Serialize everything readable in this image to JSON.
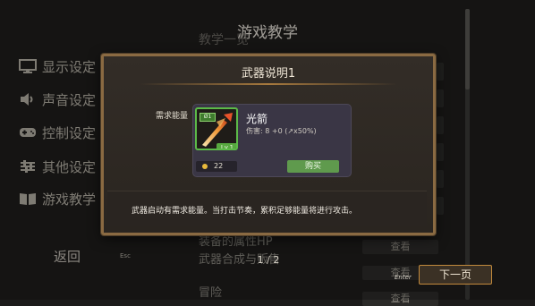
{
  "screen": {
    "title": "游戏教学"
  },
  "left_menu": {
    "items": [
      {
        "label": "显示设定",
        "icon": "monitor-icon"
      },
      {
        "label": "声音设定",
        "icon": "speaker-icon"
      },
      {
        "label": "控制设定",
        "icon": "gamepad-icon"
      },
      {
        "label": "其他设定",
        "icon": "sliders-icon"
      },
      {
        "label": "游戏教学",
        "icon": "book-icon"
      }
    ],
    "back_label": "返回",
    "back_key": "Esc"
  },
  "tutorial_list": {
    "header": "教学一览",
    "rows": [
      "装备的属性HP",
      "武器合成与贩售",
      "冒险"
    ],
    "view_label": "查看"
  },
  "pager": {
    "page": "1 / 2",
    "next_label": "下一页",
    "next_key": "Enter"
  },
  "dialog": {
    "title": "武器说明1",
    "energy_label": "需求能量",
    "weapon": {
      "name": "光箭",
      "badge": "Ø1",
      "level": "Lv.1",
      "stats": "伤害: 8 +0 (↗x50%)",
      "price": "22",
      "buy_label": "购买"
    },
    "description": "武器启动有需求能量。当打击节奏，累积足够能量将进行攻击。"
  },
  "colors": {
    "accent_gold": "#a87a3e",
    "rarity_green": "#5cba48",
    "buy_green": "#5f9a4d",
    "coin": "#e8b93c"
  }
}
